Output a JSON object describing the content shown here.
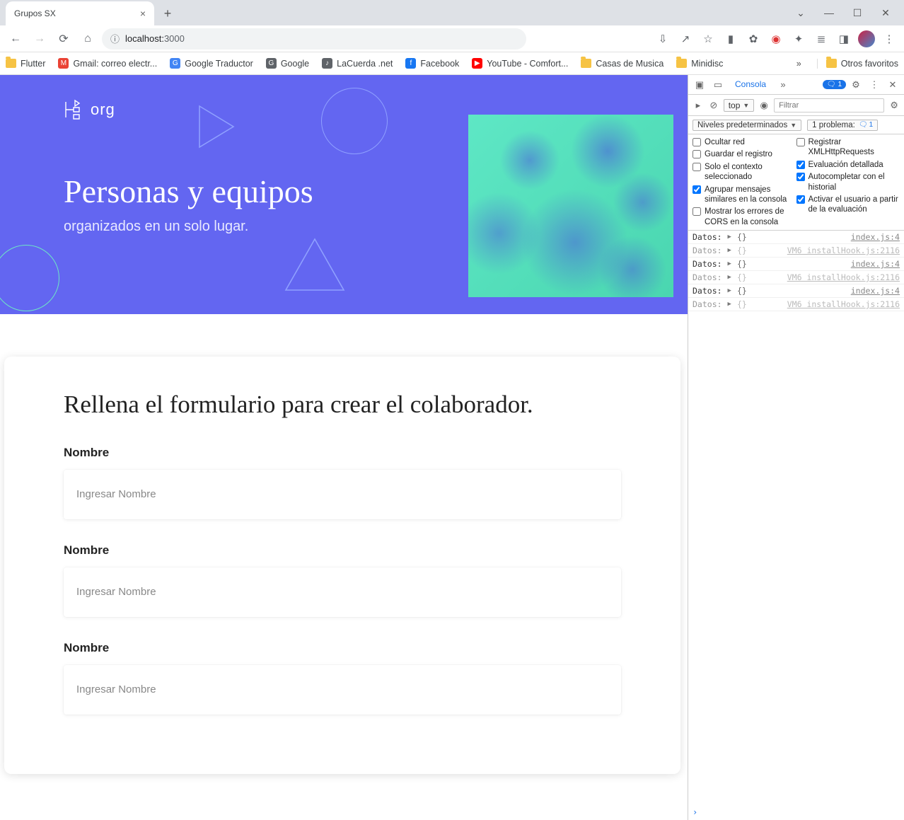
{
  "window": {
    "tab_title": "Grupos SX"
  },
  "toolbar": {
    "url_prefix": "localhost:",
    "url_port": "3000"
  },
  "bookmarks": {
    "items": [
      {
        "label": "Flutter",
        "type": "folder"
      },
      {
        "label": "Gmail: correo electr...",
        "type": "icon",
        "bg": "#ea4335"
      },
      {
        "label": "Google Traductor",
        "type": "icon",
        "bg": "#4285f4"
      },
      {
        "label": "Google",
        "type": "icon",
        "bg": "#5f6368"
      },
      {
        "label": "LaCuerda .net",
        "type": "icon",
        "bg": "#5f6368"
      },
      {
        "label": "Facebook",
        "type": "icon",
        "bg": "#1877f2"
      },
      {
        "label": "YouTube - Comfort...",
        "type": "icon",
        "bg": "#ff0000"
      },
      {
        "label": "Casas de Musica",
        "type": "folder"
      },
      {
        "label": "Minidisc",
        "type": "folder"
      }
    ],
    "other": "Otros favoritos"
  },
  "page": {
    "logo_text": "org",
    "hero_title": "Personas y equipos",
    "hero_sub": "organizados en un solo lugar.",
    "form_title": "Rellena el formulario para crear el colaborador.",
    "fields": [
      {
        "label": "Nombre",
        "placeholder": "Ingresar Nombre"
      },
      {
        "label": "Nombre",
        "placeholder": "Ingresar Nombre"
      },
      {
        "label": "Nombre",
        "placeholder": "Ingresar Nombre"
      }
    ]
  },
  "devtools": {
    "tab_active": "Consola",
    "issues_count": "1",
    "filter_placeholder": "Filtrar",
    "frame_selector": "top",
    "levels_label": "Niveles predeterminados",
    "problems_label": "1 problema:",
    "problems_count": "1",
    "checks_left": [
      {
        "label": "Ocultar red",
        "checked": false
      },
      {
        "label": "Guardar el registro",
        "checked": false
      },
      {
        "label": "Solo el contexto seleccionado",
        "checked": false
      },
      {
        "label": "Agrupar mensajes similares en la consola",
        "checked": true
      },
      {
        "label": "Mostrar los errores de CORS en la consola",
        "checked": false
      }
    ],
    "checks_right": [
      {
        "label": "Registrar XMLHttpRequests",
        "checked": false
      },
      {
        "label": "Evaluación detallada",
        "checked": true
      },
      {
        "label": "Autocompletar con el historial",
        "checked": true
      },
      {
        "label": "Activar el usuario a partir de la evaluación",
        "checked": true
      }
    ],
    "console": [
      {
        "label": "Datos:",
        "obj": "{}",
        "src": "index.js:4",
        "dim": false
      },
      {
        "label": "Datos:",
        "obj": "{}",
        "src": "VM6 installHook.js:2116",
        "dim": true
      },
      {
        "label": "Datos:",
        "obj": "{}",
        "src": "index.js:4",
        "dim": false
      },
      {
        "label": "Datos:",
        "obj": "{}",
        "src": "VM6 installHook.js:2116",
        "dim": true
      },
      {
        "label": "Datos:",
        "obj": "{}",
        "src": "index.js:4",
        "dim": false
      },
      {
        "label": "Datos:",
        "obj": "{}",
        "src": "VM6 installHook.js:2116",
        "dim": true
      }
    ]
  }
}
